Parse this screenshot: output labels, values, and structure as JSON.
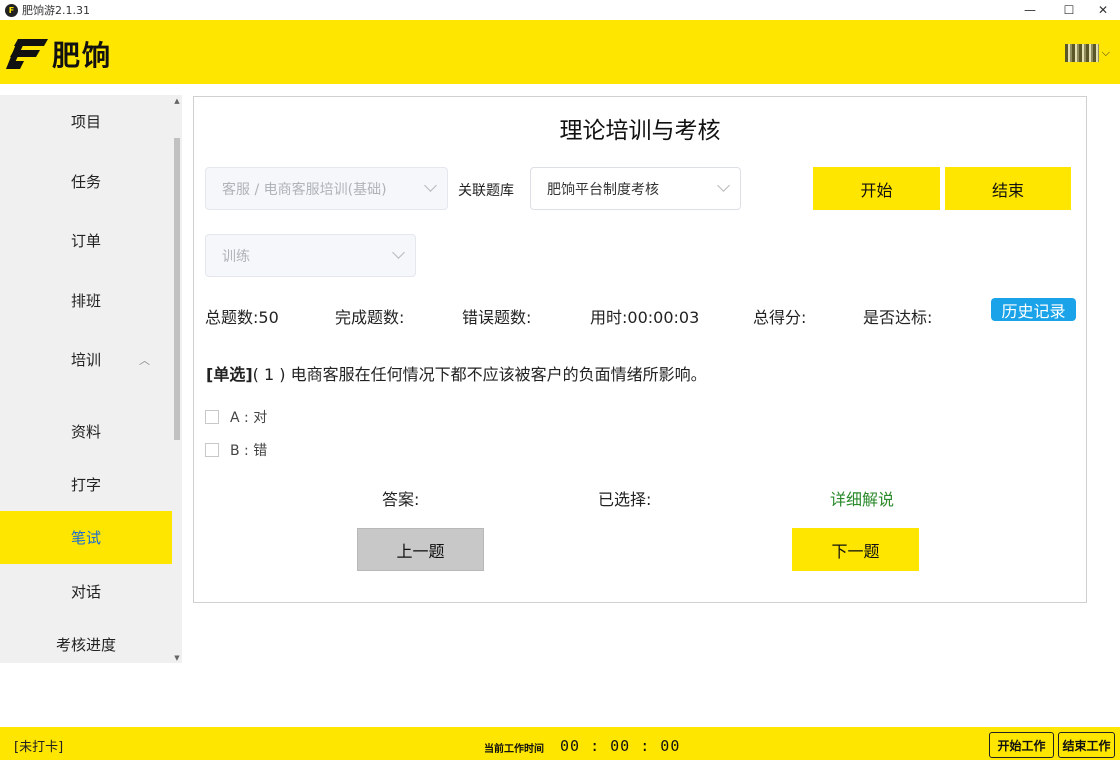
{
  "window": {
    "title": "肥饷游2.1.31",
    "minimize": "—",
    "maximize": "☐",
    "close": "✕"
  },
  "header": {
    "logo_text": "肥饷",
    "user_caret": "⌵"
  },
  "sidebar": {
    "items": [
      {
        "label": "项目"
      },
      {
        "label": "任务"
      },
      {
        "label": "订单"
      },
      {
        "label": "排班"
      },
      {
        "label": "培训",
        "arrow": "︿"
      },
      {
        "label": "资料"
      },
      {
        "label": "打字"
      },
      {
        "label": "笔试",
        "active": true
      },
      {
        "label": "对话"
      },
      {
        "label": "考核进度"
      }
    ]
  },
  "exam": {
    "title": "理论培训与考核",
    "course_select": "客服 / 电商客服培训(基础)",
    "bank_label": "关联题库",
    "bank_select": "肥饷平台制度考核",
    "mode_select": "训练",
    "start_label": "开始",
    "end_label": "结束",
    "stats": {
      "total": "总题数:50",
      "completed": "完成题数:",
      "wrong": "错误题数:",
      "time": "用时:00:00:03",
      "score": "总得分:",
      "pass": "是否达标:"
    },
    "history_label": "历史记录",
    "question": {
      "type": "[单选]",
      "text": "( 1 ) 电商客服在任何情况下都不应该被客户的负面情绪所影响。",
      "options": [
        {
          "label": "A : 对"
        },
        {
          "label": "B : 错"
        }
      ]
    },
    "answer_label": "答案:",
    "selected_label": "已选择:",
    "detail_label": "详细解说",
    "prev_label": "上一题",
    "next_label": "下一题"
  },
  "footer": {
    "clock_status": "[未打卡]",
    "work_time_label": "当前工作时间",
    "work_time": "00 : 00 : 00",
    "start_work_label": "开始工作",
    "end_work_label": "结束工作"
  },
  "colors": {
    "brand_yellow": "#ffe600",
    "history_blue": "#1aa3e8",
    "active_text": "#1a6cd1",
    "detail_green": "#2a8a2a"
  }
}
